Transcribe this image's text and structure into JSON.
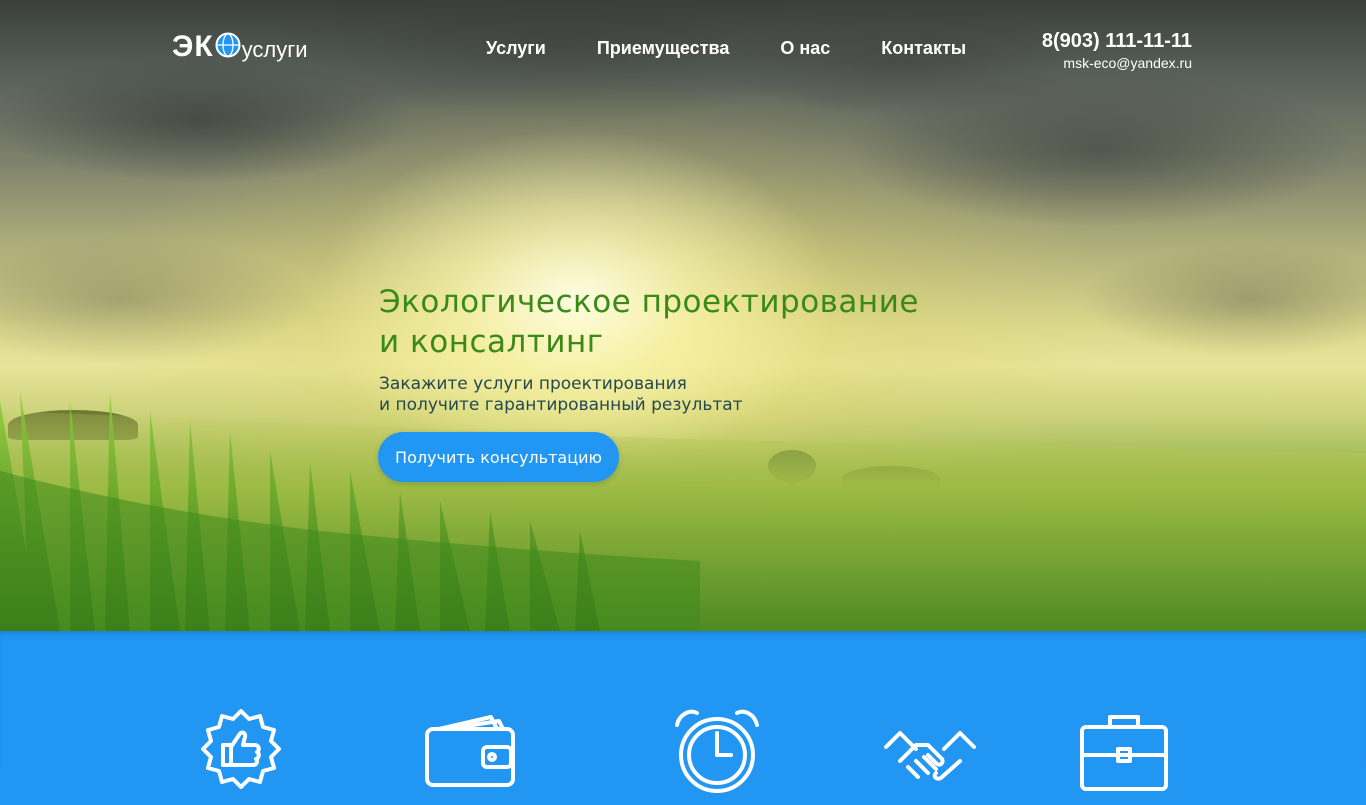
{
  "header": {
    "logo": {
      "main": "ЭК",
      "sub": "услуги"
    },
    "nav": [
      "Услуги",
      "Приемущества",
      "О нас",
      "Контакты"
    ],
    "contact": {
      "phone": "8(903) 111-11-11",
      "email": "msk-eco@yandex.ru"
    }
  },
  "hero": {
    "headline": [
      "Экологическое проектирование",
      "и консалтинг"
    ],
    "subline": [
      "Закажите услуги проектирования",
      "и получите гарантированный результат"
    ],
    "cta_label": "Получить консультацию"
  },
  "features": {
    "icons": [
      "badge-thumbs-up-icon",
      "wallet-icon",
      "alarm-clock-icon",
      "handshake-icon",
      "briefcase-icon"
    ]
  },
  "colors": {
    "accent": "#2196f3",
    "headline": "#3b8a18",
    "subline": "#234a50",
    "text_light": "#ffffff"
  }
}
